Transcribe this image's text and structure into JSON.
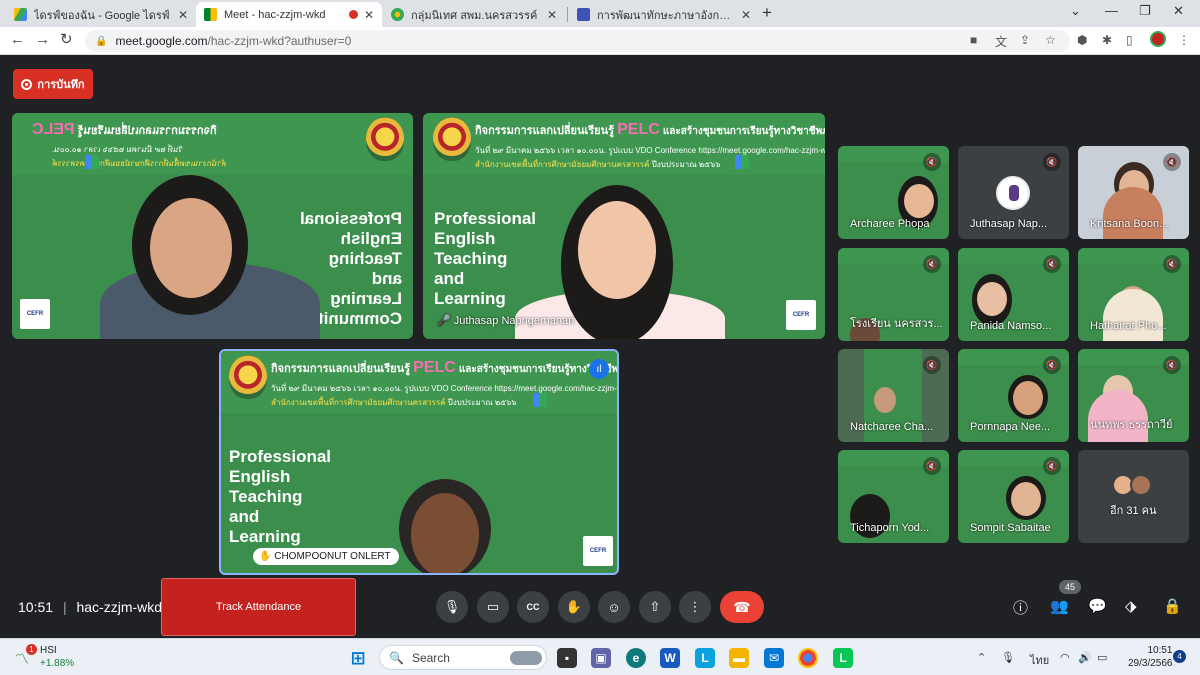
{
  "browser": {
    "tabs": [
      {
        "label": "ไดรฟ์ของฉัน - Google ไดรฟ์",
        "color": "#1a73e8"
      },
      {
        "label": "Meet - hac-zzjm-wkd",
        "color": "#00832d"
      },
      {
        "label": "กลุ่มนิเทศ สพม.นครสวรรค์",
        "color": "#34a853"
      },
      {
        "label": "การพัฒนาทักษะภาษาอังกฤษ English",
        "color": "#3f51b5"
      }
    ],
    "url_host": "meet.google.com",
    "url_path": "/hac-zzjm-wkd?authuser=0"
  },
  "meet": {
    "recording_label": "การบันทึก",
    "banner": {
      "line1_before": "กิจกรรมการแลกเปลี่ยนเรียนรู้",
      "pelc": "PELC",
      "line1_after": "และสร้างชุมชนการเรียนรู้ทางวิชาชีพภาษาอังกฤษ",
      "line2": "วันที่ ๒๙ มีนาคม ๒๕๖๖ เวลา ๑๐.๐๐น.",
      "line2b": "รูปแบบ VDO Conference https://meet.google.com/hac-zzjm-wkd",
      "line3": "สำนักงานเขตพื้นที่การศึกษามัธยมศึกษานครสวรรค์",
      "line3b": "ปีงบประมาณ ๒๕๖๖",
      "pet_lines": [
        "Professional",
        "English",
        "Teaching",
        "and",
        "Learning",
        "Community"
      ],
      "cefr": "CEFR"
    },
    "tile_names": {
      "juthasap_large": "Juthasap Napngernanan",
      "chompoonut": "CHOMPOONUT ONLERT"
    },
    "participants": [
      {
        "name": "Archaree Phopa"
      },
      {
        "name": "Juthasap Nap..."
      },
      {
        "name": "Kritsana Boon..."
      },
      {
        "name": "โรงเรียน นครสวร..."
      },
      {
        "name": "Panida Namso..."
      },
      {
        "name": "Hathairat Pho..."
      },
      {
        "name": "Natcharee Cha..."
      },
      {
        "name": "Pornnapa Nee..."
      },
      {
        "name": "นนทพร ธรรถาวีย์"
      },
      {
        "name": "Tichaporn Yod..."
      },
      {
        "name": "Sompit Sabaitae"
      }
    ],
    "others_label": "อีก 31 คน",
    "meeting_time": "10:51",
    "meeting_code": "hac-zzjm-wkd",
    "track_attendance": "Track Attendance",
    "people_count": "45"
  },
  "taskbar": {
    "hsi_label": "HSI",
    "hsi_change": "+1.88%",
    "hsi_badge": "1",
    "search_placeholder": "Search",
    "lang": "ไทย",
    "time": "10:51",
    "date": "29/3/2566",
    "notif_count": "4"
  }
}
